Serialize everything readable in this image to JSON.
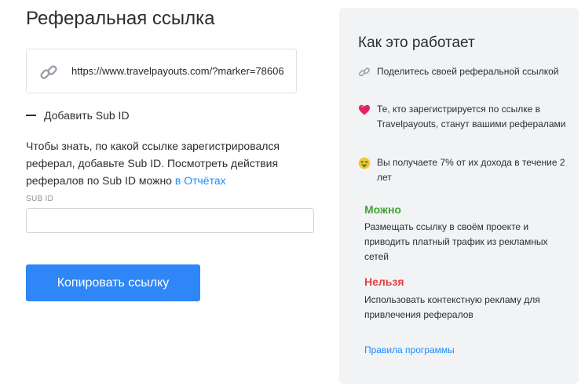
{
  "left": {
    "title": "Реферальная ссылка",
    "referral_link": "https://www.travelpayouts.com/?marker=78606",
    "subid_toggle_label": "Добавить Sub ID",
    "description_text": "Чтобы знать, по какой ссылке зарегистрировался реферал, добавьте Sub ID. Посмотреть действия рефералов по Sub ID можно ",
    "description_link": "в Отчётах",
    "subid_label": "SUB ID",
    "subid_value": "",
    "subid_placeholder": "",
    "copy_button_label": "Копировать ссылку"
  },
  "right": {
    "title": "Как это работает",
    "steps": [
      {
        "icon": "link-icon",
        "text": "Поделитесь своей реферальной ссылкой"
      },
      {
        "icon": "heart-icon",
        "text": "Те, кто зарегистрируется по ссылке в Travelpayouts, станут вашими рефералами"
      },
      {
        "icon": "money-face-icon",
        "text": "Вы получаете 7% от их дохода в течение 2 лет"
      }
    ],
    "allowed_title": "Можно",
    "allowed_text": "Размещать ссылку в своём проекте и приводить платный трафик из рекламных сетей",
    "forbidden_title": "Нельзя",
    "forbidden_text": "Использовать контекстную рекламу для привлечения рефералов",
    "rules_link": "Правила программы"
  },
  "colors": {
    "accent": "#2f86f6",
    "link": "#1a8cff",
    "allowed": "#3fa535",
    "forbidden": "#e04343",
    "panel_bg": "#f1f3f5"
  }
}
